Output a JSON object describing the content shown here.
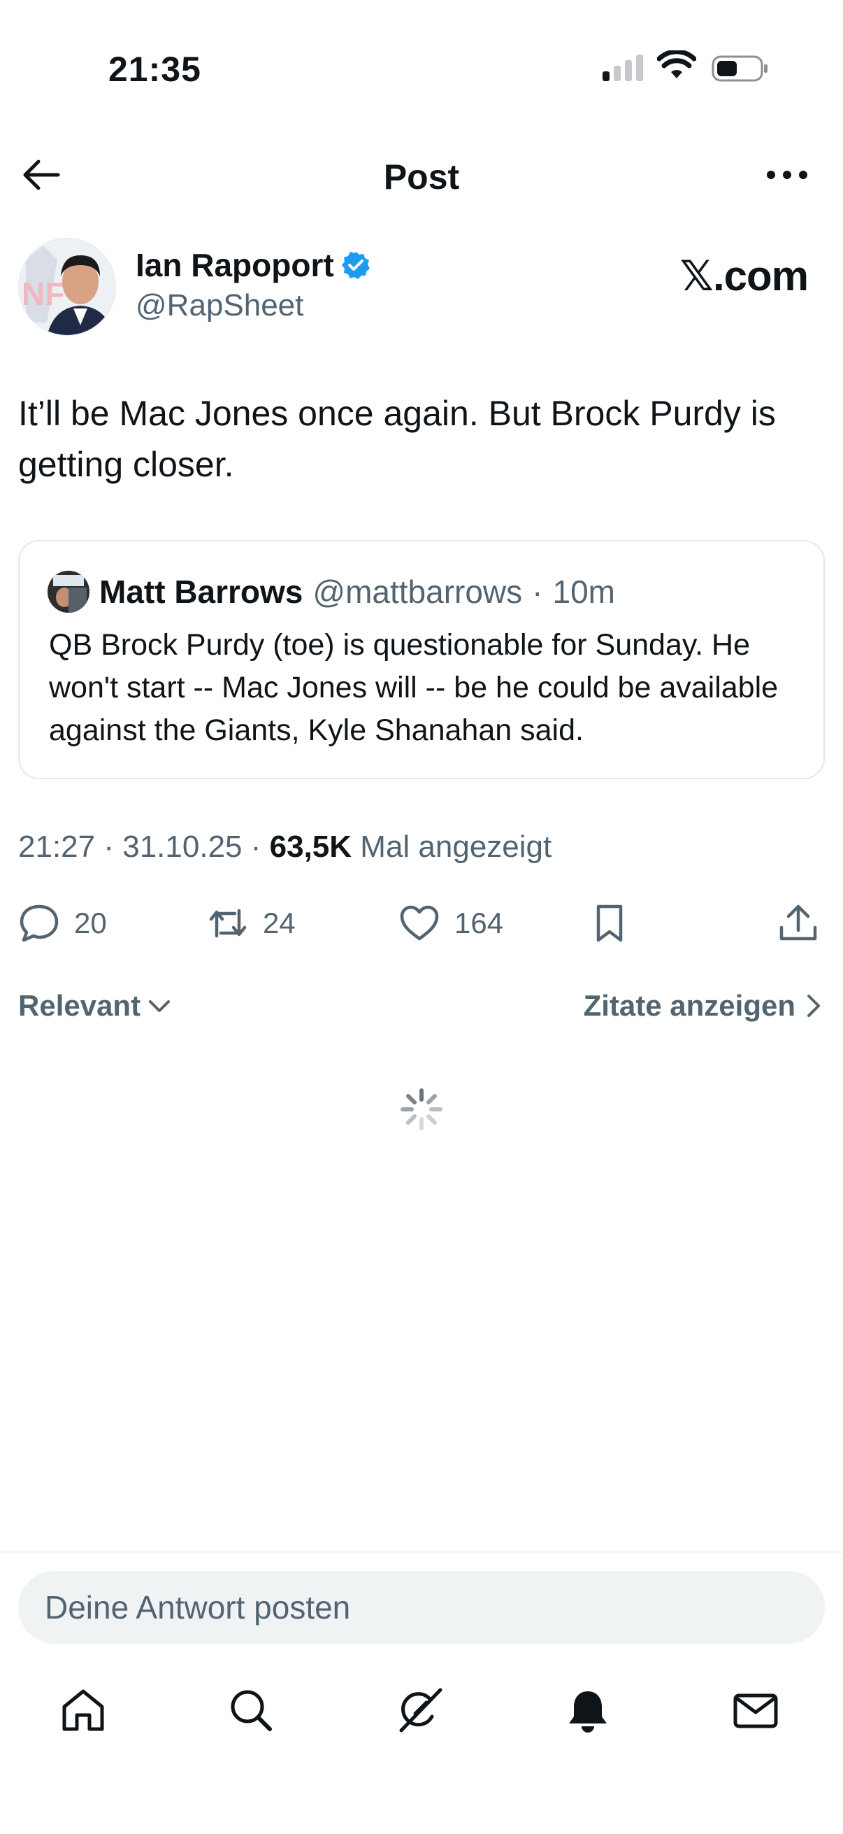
{
  "status_bar": {
    "time": "21:35"
  },
  "header": {
    "title": "Post"
  },
  "author": {
    "name": "Ian Rapoport",
    "handle": "@RapSheet",
    "watermark": "𝕏.com"
  },
  "tweet": {
    "text": "It’ll be Mac Jones once again. But Brock Purdy is getting closer."
  },
  "quote": {
    "name": "Matt Barrows",
    "handle": "@mattbarrows",
    "separator": "·",
    "time": "10m",
    "text": "QB Brock Purdy (toe) is questionable for Sunday. He won't start -- Mac Jones will -- be he could be available against the Giants, Kyle Shanahan said."
  },
  "meta": {
    "time": "21:27",
    "date": "31.10.25",
    "views": "63,5K",
    "views_label": "Mal angezeigt",
    "sep": "·"
  },
  "actions": {
    "replies": "20",
    "reposts": "24",
    "likes": "164"
  },
  "sort": {
    "relevant_label": "Relevant",
    "quotes_label": "Zitate anzeigen"
  },
  "reply": {
    "placeholder": "Deine Antwort posten"
  },
  "icons": {
    "back": "arrow-left-icon",
    "more": "more-horizontal-icon",
    "verified": "verified-badge-icon",
    "reply": "comment-icon",
    "repost": "repost-icon",
    "like": "heart-icon",
    "bookmark": "bookmark-icon",
    "share": "share-icon",
    "home": "home-icon",
    "search": "search-icon",
    "grok": "grok-icon",
    "notifications": "bell-icon",
    "messages": "mail-icon"
  },
  "colors": {
    "text_primary": "#0f1419",
    "text_secondary": "#536471",
    "verified_blue": "#1d9bf0",
    "border": "#e1e8ed",
    "input_bg": "#eff3f4"
  }
}
